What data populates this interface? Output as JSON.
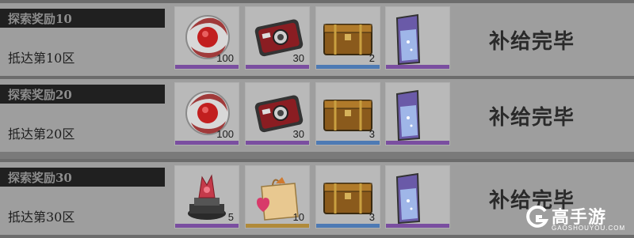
{
  "rows": [
    {
      "header": "探索奖励10",
      "subtitle": "抵达第10区",
      "status": "补给完毕",
      "items": [
        {
          "icon": "red-core-icon",
          "qty": "100",
          "rarity_color": "#7a4ea0"
        },
        {
          "icon": "camera-device-icon",
          "qty": "30",
          "rarity_color": "#7a4ea0"
        },
        {
          "icon": "supply-crate-icon",
          "qty": "2",
          "rarity_color": "#4d7ab4"
        },
        {
          "icon": "potion-jar-icon",
          "qty": "",
          "rarity_color": "#7a4ea0"
        }
      ]
    },
    {
      "header": "探索奖励20",
      "subtitle": "抵达第20区",
      "status": "补给完毕",
      "items": [
        {
          "icon": "red-core-icon",
          "qty": "100",
          "rarity_color": "#7a4ea0"
        },
        {
          "icon": "camera-device-icon",
          "qty": "30",
          "rarity_color": "#7a4ea0"
        },
        {
          "icon": "supply-crate-icon",
          "qty": "3",
          "rarity_color": "#4d7ab4"
        },
        {
          "icon": "potion-jar-icon",
          "qty": "",
          "rarity_color": "#7a4ea0"
        }
      ]
    },
    {
      "header": "探索奖励30",
      "subtitle": "抵达第30区",
      "status": "补给完毕",
      "items": [
        {
          "icon": "crystal-pedestal-icon",
          "qty": "5",
          "rarity_color": "#7a4ea0"
        },
        {
          "icon": "gift-bag-icon",
          "qty": "10",
          "rarity_color": "#b08a3a"
        },
        {
          "icon": "supply-crate-icon",
          "qty": "3",
          "rarity_color": "#4d7ab4"
        },
        {
          "icon": "potion-jar-icon",
          "qty": "",
          "rarity_color": "#7a4ea0"
        }
      ]
    }
  ],
  "watermark": {
    "name": "高手游",
    "url": "GAOSHOUYOU.COM"
  }
}
